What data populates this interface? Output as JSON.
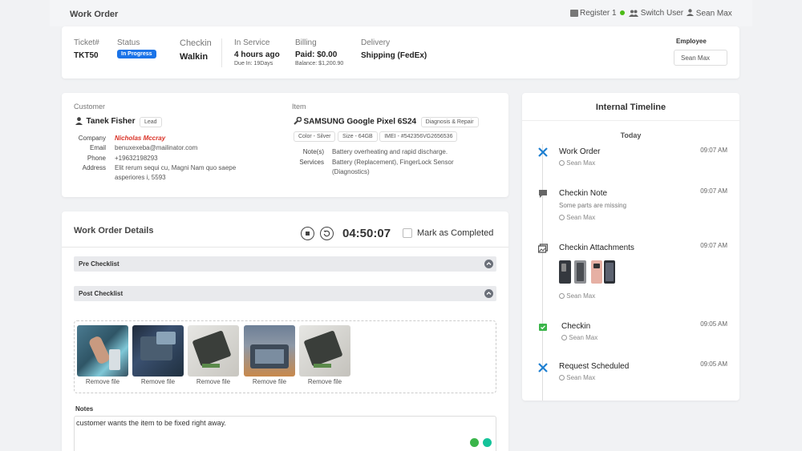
{
  "header": {
    "title": "Work Order",
    "register": "Register 1",
    "switch_user": "Switch User",
    "user": "Sean Max"
  },
  "summary": {
    "ticket_label": "Ticket#",
    "ticket_value": "TKT50",
    "status_label": "Status",
    "status_value": "In Progress",
    "checkin_label": "Checkin",
    "checkin_value": "Walkin",
    "service_label": "In Service",
    "service_value": "4 hours ago",
    "service_due": "Due In: 19Days",
    "billing_label": "Billing",
    "billing_value": "Paid: $0.00",
    "billing_balance": "Balance: $1,200.90",
    "delivery_label": "Delivery",
    "delivery_value": "Shipping (FedEx)",
    "employee_label": "Employee",
    "employee_value": "Sean Max"
  },
  "customer": {
    "section_label": "Customer",
    "name": "Tanek Fisher",
    "badge": "Lead",
    "company_label": "Company",
    "company_value": "Nicholas Mccray",
    "email_label": "Email",
    "email_value": "benuxexeba@mailinator.com",
    "phone_label": "Phone",
    "phone_value": "+19632198293",
    "address_label": "Address",
    "address_line1": "Elit rerum sequi cu, Magni Nam quo saepe",
    "address_line2": "asperiores i, 5593"
  },
  "item": {
    "section_label": "Item",
    "name": "SAMSUNG Google Pixel 6S24",
    "type_badge": "Diagnosis & Repair",
    "color": "Color - Silver",
    "size": "Size - 64GB",
    "imei": "IMEI - #542356VG2656536",
    "notes_label": "Note(s)",
    "notes_value": "Battery overheating and rapid discharge.",
    "services_label": "Services",
    "services_line1": "Battery (Replacement), FingerLock Sensor",
    "services_line2": "(Diagnostics)"
  },
  "details": {
    "title": "Work Order Details",
    "timer": "04:50:07",
    "mark_completed": "Mark as Completed",
    "pre_checklist": "Pre Checklist",
    "post_checklist": "Post Checklist",
    "remove_file": "Remove file",
    "notes_label": "Notes",
    "notes_text": "customer wants the item to be fixed right away."
  },
  "timeline": {
    "title": "Internal Timeline",
    "day": "Today",
    "entries": [
      {
        "title": "Work Order",
        "time": "09:07 AM",
        "user": "Sean Max"
      },
      {
        "title": "Checkin Note",
        "time": "09:07 AM",
        "note": "Some parts are missing",
        "user": "Sean Max"
      },
      {
        "title": "Checkin Attachments",
        "time": "09:07 AM",
        "user": "Sean Max"
      },
      {
        "title": "Checkin",
        "time": "09:05 AM",
        "user": "Sean Max"
      },
      {
        "title": "Request Scheduled",
        "time": "09:05 AM",
        "user": "Sean Max"
      }
    ]
  },
  "colors": {
    "accent": "#1a73e8",
    "status_green": "#4cbb17",
    "company_red": "#d93025",
    "timeline_blue": "#1d7fd1",
    "timeline_green": "#3bb54a"
  }
}
